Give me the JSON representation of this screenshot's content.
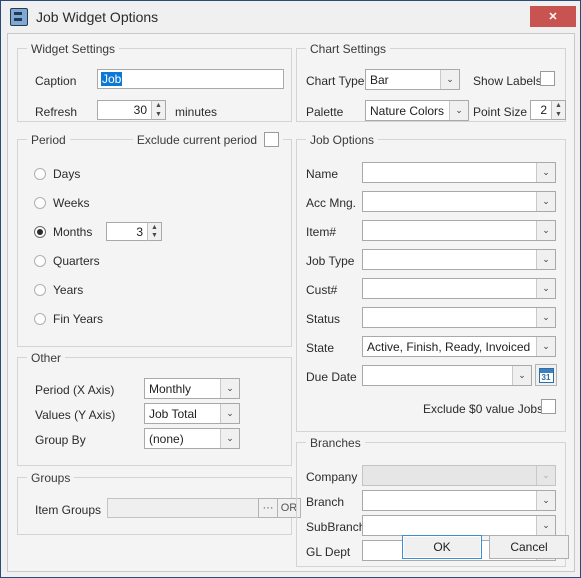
{
  "window": {
    "title": "Job Widget Options",
    "app_icon": "app-icon",
    "close_label": "✕",
    "accent_blue": "#0a78d4",
    "close_red": "#c75450",
    "border_navy": "#2a4a7c"
  },
  "widget_settings": {
    "legend": "Widget Settings",
    "caption_label": "Caption",
    "caption_value": "Job",
    "refresh_label": "Refresh",
    "refresh_value": "30",
    "refresh_units": "minutes"
  },
  "period": {
    "legend": "Period",
    "exclude_current_label": "Exclude current period",
    "exclude_current_checked": false,
    "options": [
      {
        "label": "Days",
        "checked": false
      },
      {
        "label": "Weeks",
        "checked": false
      },
      {
        "label": "Months",
        "checked": true
      },
      {
        "label": "Quarters",
        "checked": false
      },
      {
        "label": "Years",
        "checked": false
      },
      {
        "label": "Fin Years",
        "checked": false
      }
    ],
    "months_value": "3"
  },
  "other": {
    "legend": "Other",
    "rows": [
      {
        "label": "Period (X Axis)",
        "value": "Monthly"
      },
      {
        "label": "Values (Y Axis)",
        "value": "Job Total"
      },
      {
        "label": "Group By",
        "value": "(none)"
      }
    ]
  },
  "groups": {
    "legend": "Groups",
    "item_groups_label": "Item Groups",
    "item_groups_value": "",
    "ellipsis_label": "···",
    "or_label": "OR"
  },
  "chart_settings": {
    "legend": "Chart Settings",
    "chart_type_label": "Chart Type",
    "chart_type_value": "Bar",
    "show_labels_label": "Show Labels",
    "show_labels_checked": false,
    "palette_label": "Palette",
    "palette_value": "Nature Colors",
    "point_size_label": "Point Size",
    "point_size_value": "2"
  },
  "job_options": {
    "legend": "Job Options",
    "rows": [
      {
        "label": "Name",
        "value": ""
      },
      {
        "label": "Acc Mng.",
        "value": ""
      },
      {
        "label": "Item#",
        "value": ""
      },
      {
        "label": "Job Type",
        "value": ""
      },
      {
        "label": "Cust#",
        "value": ""
      },
      {
        "label": "Status",
        "value": ""
      },
      {
        "label": "State",
        "value": "Active, Finish, Ready, Invoiced"
      },
      {
        "label": "Due Date",
        "value": ""
      }
    ],
    "calendar_day": "31",
    "exclude_zero_label": "Exclude $0 value Jobs",
    "exclude_zero_checked": false
  },
  "branches": {
    "legend": "Branches",
    "rows": [
      {
        "label": "Company",
        "value": "",
        "disabled": true
      },
      {
        "label": "Branch",
        "value": "",
        "disabled": false
      },
      {
        "label": "SubBranch",
        "value": "",
        "disabled": false
      },
      {
        "label": "GL Dept",
        "value": "",
        "disabled": false
      }
    ]
  },
  "footer": {
    "ok_label": "OK",
    "cancel_label": "Cancel"
  }
}
